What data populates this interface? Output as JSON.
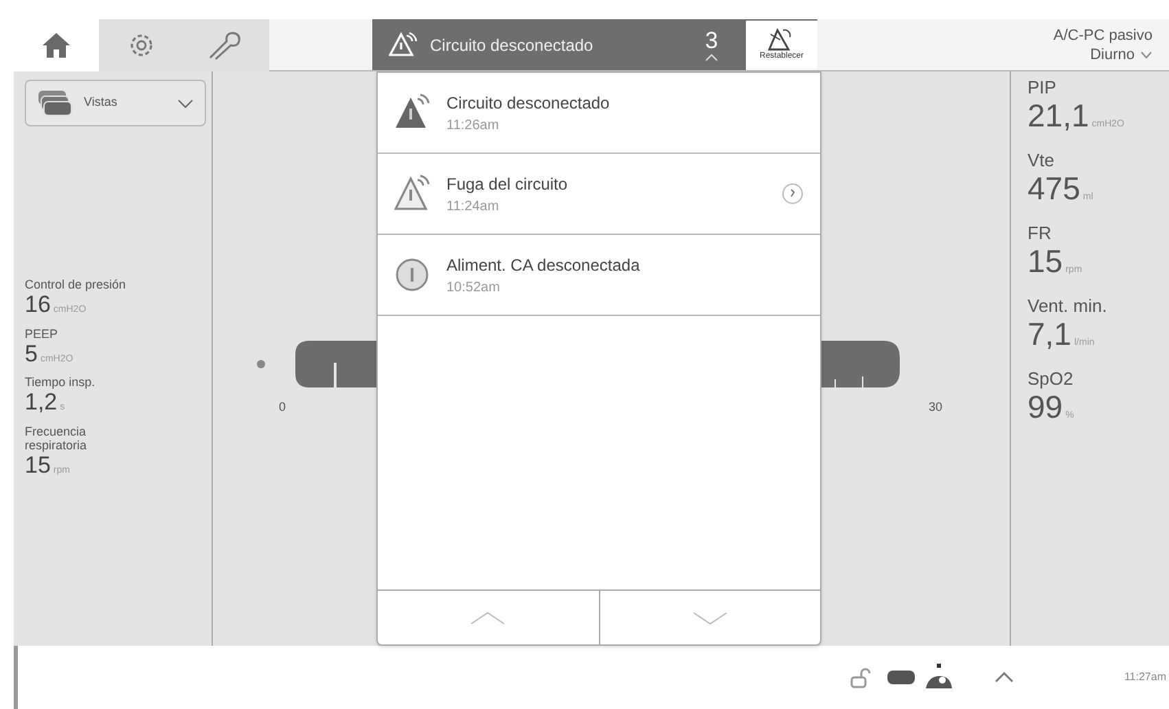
{
  "top_tabs": [
    {
      "kind": "home",
      "selected": true
    },
    {
      "kind": "settings",
      "selected": false
    },
    {
      "kind": "tools",
      "selected": false
    }
  ],
  "alarm_header": {
    "title": "Circuito desconectado",
    "count": "3",
    "reset_label": "Restablecer"
  },
  "mode": {
    "name": "A/C-PC pasivo",
    "schedule": "Diurno"
  },
  "view_selector": {
    "label": "Vistas"
  },
  "settings": [
    {
      "label": "Control de presión",
      "value": "16",
      "unit": "cmH2O"
    },
    {
      "label": "PEEP",
      "value": "5",
      "unit": "cmH2O"
    },
    {
      "label": "Tiempo insp.",
      "value": "1,2",
      "unit": "s"
    },
    {
      "label": "Frecuencia respiratoria",
      "value": "15",
      "unit": "rpm"
    }
  ],
  "waveform": {
    "axis_labels": [
      "0",
      "30"
    ]
  },
  "alarms": [
    {
      "kind": "high",
      "title": "Circuito desconectado",
      "time": "11:26am",
      "timer": false
    },
    {
      "kind": "medium",
      "title": "Fuga del circuito",
      "time": "11:24am",
      "timer": true
    },
    {
      "kind": "info",
      "title": "Aliment. CA desconectada",
      "time": "10:52am",
      "timer": false
    }
  ],
  "measurements": [
    {
      "label": "PIP",
      "value": "21,1",
      "unit": "cmH2O"
    },
    {
      "label": "Vte",
      "value": "475",
      "unit": "ml"
    },
    {
      "label": "FR",
      "value": "15",
      "unit": "rpm"
    },
    {
      "label": "Vent. min.",
      "value": "7,1",
      "unit": "l/min"
    },
    {
      "label": "SpO2",
      "value": "99",
      "unit": "%"
    }
  ],
  "status_bar": {
    "time": "11:27am"
  }
}
